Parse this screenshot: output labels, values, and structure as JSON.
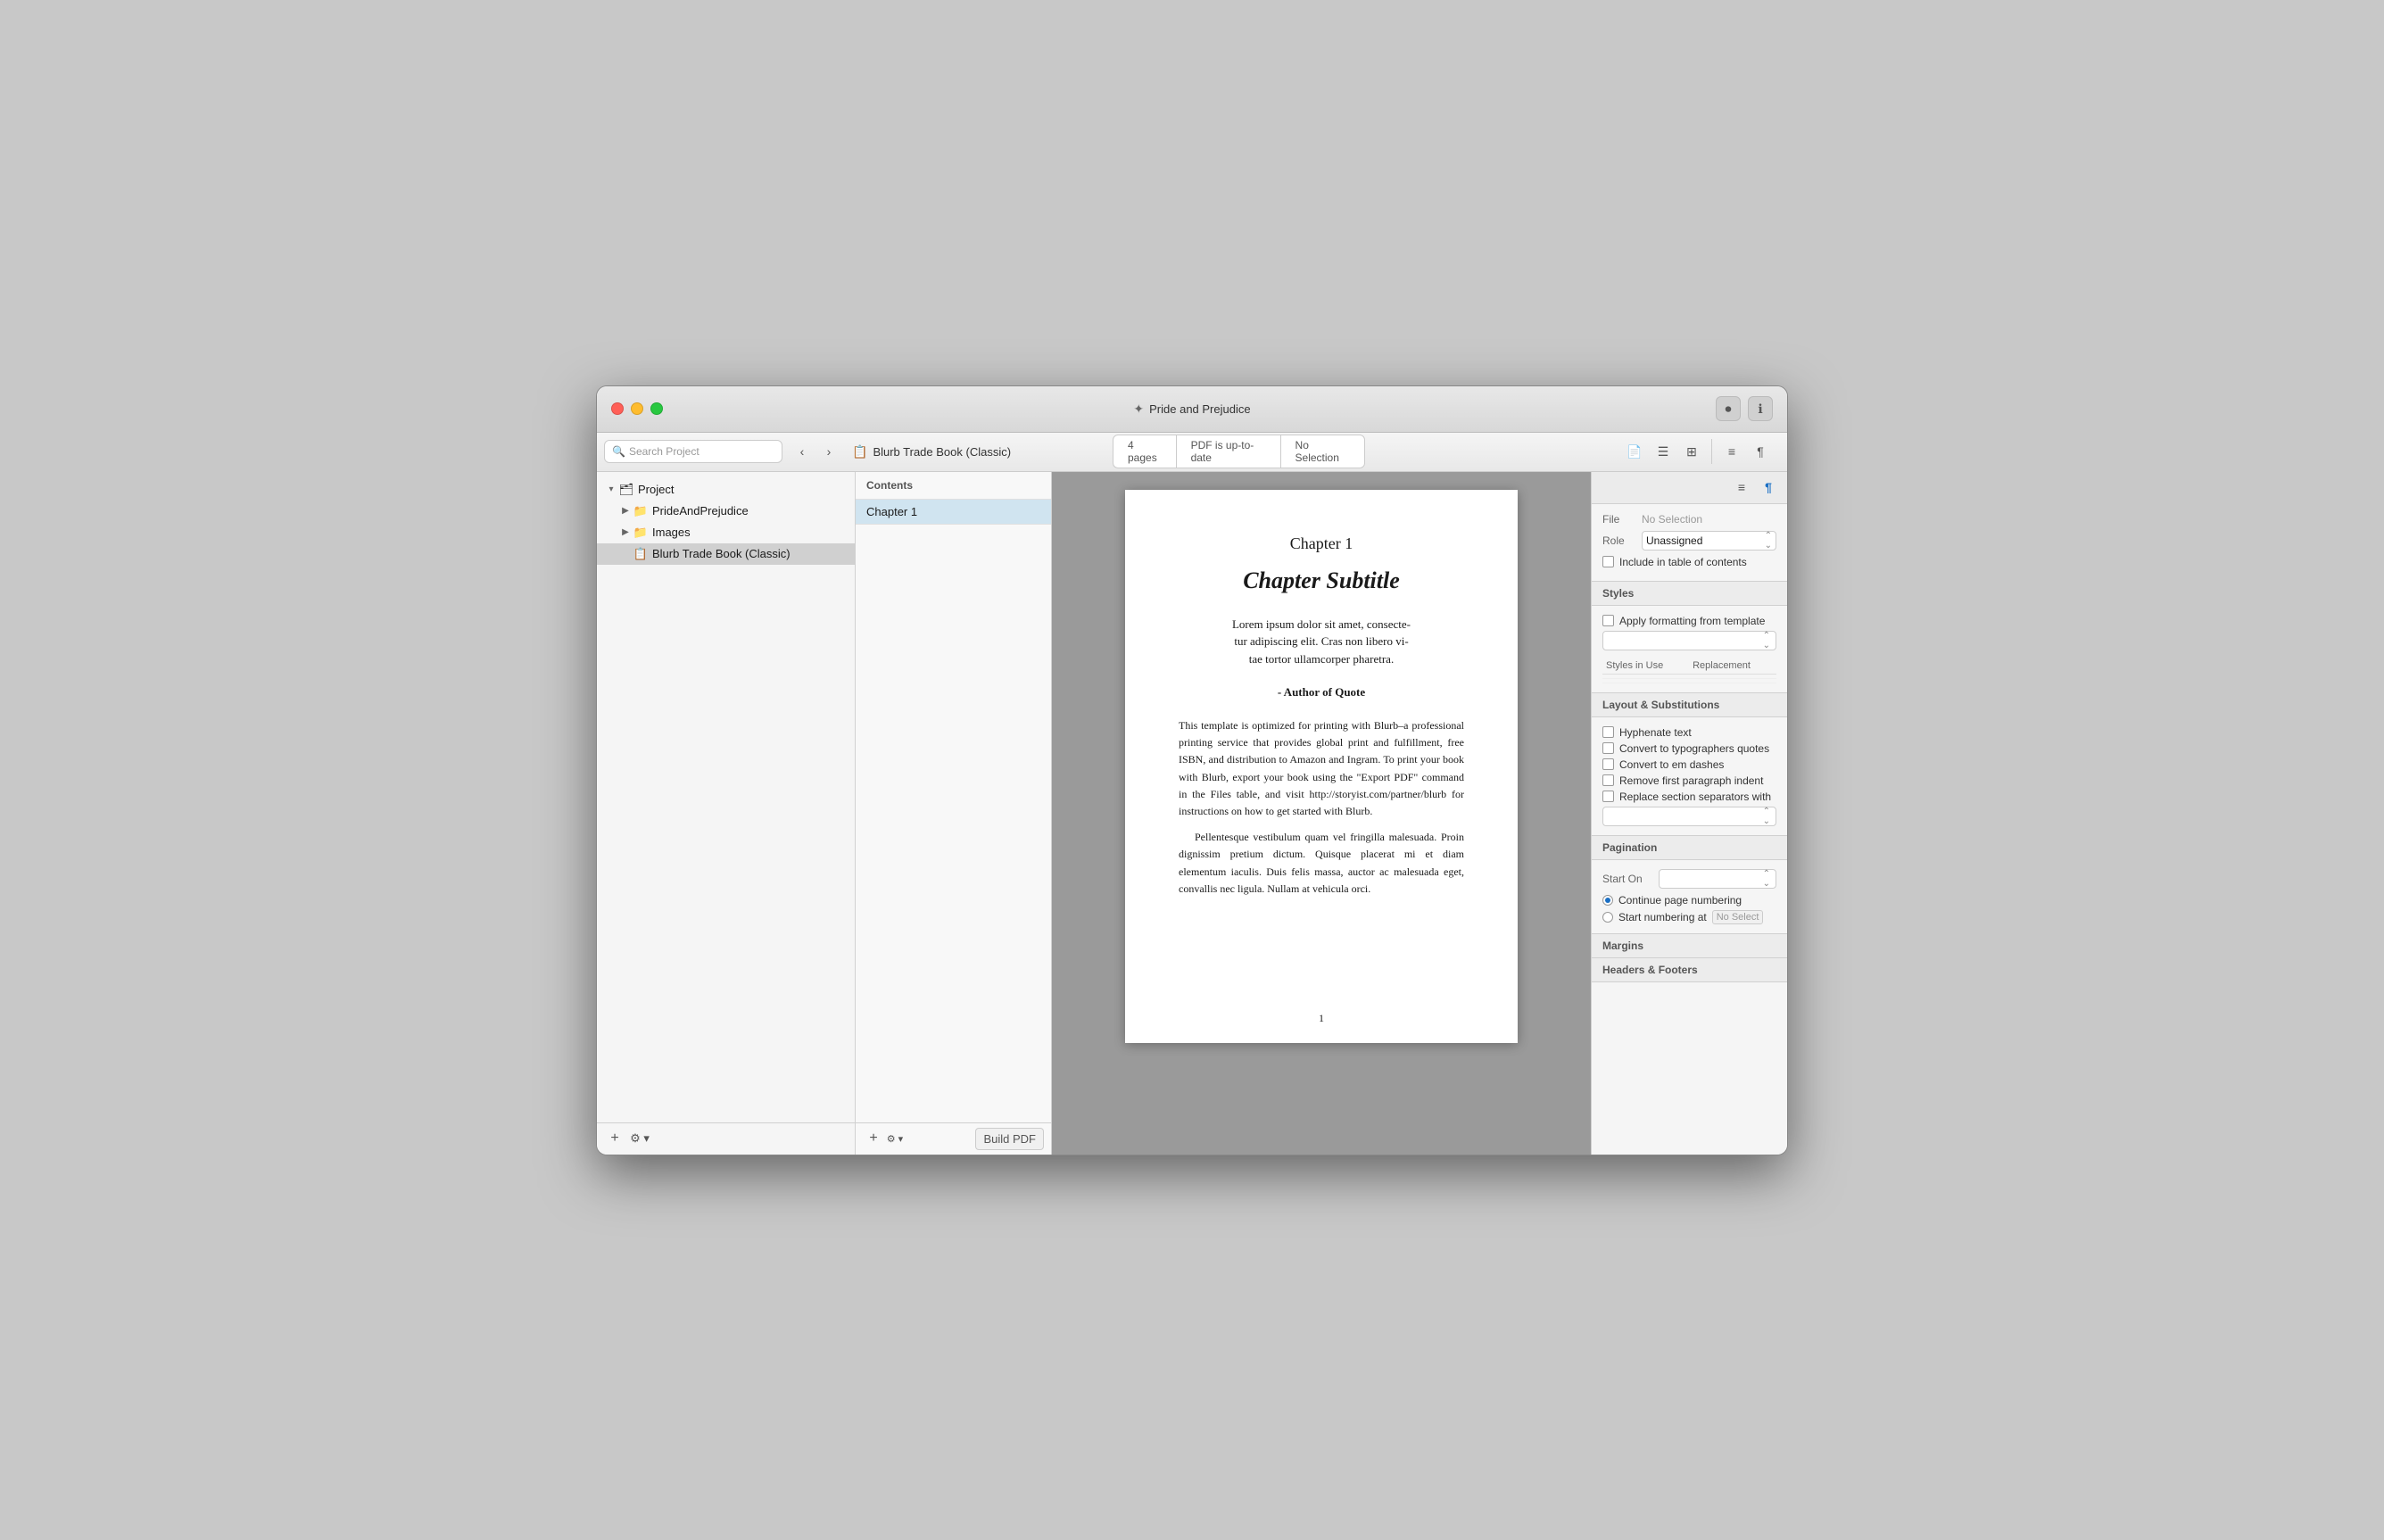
{
  "window": {
    "title": "Pride and Prejudice",
    "title_icon": "✦"
  },
  "titlebar": {
    "right_buttons": [
      "⏺",
      "ℹ"
    ]
  },
  "toolbar": {
    "search_placeholder": "Search Project",
    "nav_back": "‹",
    "nav_forward": "›",
    "doc_icon": "📄",
    "doc_name": "Blurb Trade Book (Classic)",
    "status": {
      "pages": "4 pages",
      "pdf_status": "PDF is up-to-date",
      "selection": "No Selection"
    },
    "view_icons": [
      "☰",
      "⊞"
    ],
    "right_icons": [
      "≡",
      "¶"
    ]
  },
  "sidebar": {
    "items": [
      {
        "label": "Project",
        "level": 0,
        "expand": "▾",
        "icon": "🗂",
        "type": "root"
      },
      {
        "label": "PrideAndPrejudice",
        "level": 1,
        "expand": "▶",
        "icon": "📁",
        "type": "folder"
      },
      {
        "label": "Images",
        "level": 1,
        "expand": "▶",
        "icon": "📁",
        "type": "folder",
        "color": "blue"
      },
      {
        "label": "Blurb Trade Book (Classic)",
        "level": 1,
        "expand": "",
        "icon": "📋",
        "type": "template",
        "selected": true
      }
    ],
    "add_btn": "+",
    "settings_btn": "⚙"
  },
  "contents": {
    "header": "Contents",
    "items": [
      {
        "label": "Chapter 1"
      }
    ],
    "add_btn": "+",
    "settings_btn": "⚙",
    "build_btn": "Build PDF"
  },
  "page": {
    "chapter_title": "Chapter 1",
    "chapter_subtitle": "Chapter Subtitle",
    "quote_text": "Lorem ipsum dolor sit amet, consecte-\ntur adipiscing elit. Cras non libero vi-\ntae tortor ullamcorper pharetra.",
    "quote_author": "- Author of Quote",
    "body_para1": "This template is optimized for printing with Blurb–a professional printing service that provides global print and fulfillment, free ISBN, and distribution to Amazon and Ingram. To print your book with Blurb,    export your book using the \"Export PDF\" command in the Files table, and visit http://storyist.com/partner/blurb for instructions on how to get started with Blurb.",
    "body_para2": "Pellentesque vestibulum quam vel fringilla malesuada. Proin dignissim pretium dictum. Quisque placerat mi et diam elementum iaculis. Duis felis massa, auctor ac malesuada eget, convallis nec ligula. Nullam at vehicula orci.",
    "page_number": "1"
  },
  "inspector": {
    "file_label": "File",
    "file_value": "No Selection",
    "role_label": "Role",
    "role_value": "Unassigned",
    "include_toc_label": "Include in table of contents",
    "styles_section": "Styles",
    "apply_template_label": "Apply formatting from template",
    "styles_in_use_header": "Styles in Use",
    "replacement_header": "Replacement",
    "layout_section": "Layout & Substitutions",
    "hyphenate_label": "Hyphenate text",
    "typo_quotes_label": "Convert to typographers quotes",
    "em_dashes_label": "Convert to em dashes",
    "first_para_indent_label": "Remove first paragraph indent",
    "section_sep_label": "Replace section separators with",
    "pagination_section": "Pagination",
    "start_on_label": "Start On",
    "continue_numbering_label": "Continue page numbering",
    "start_numbering_label": "Start numbering at",
    "no_select_label": "No Select",
    "margins_section": "Margins",
    "headers_footers_section": "Headers & Footers"
  }
}
